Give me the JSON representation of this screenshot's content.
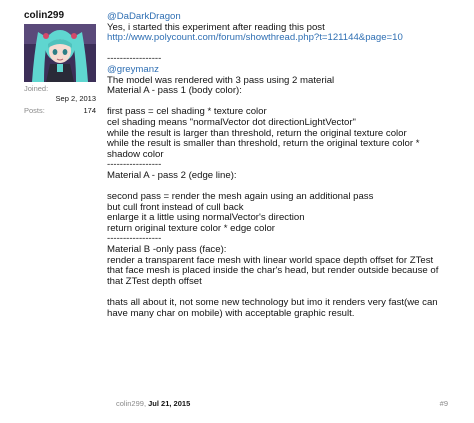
{
  "author": {
    "username": "colin299",
    "joined_label": "Joined:",
    "joined_value": "Sep 2, 2013",
    "posts_label": "Posts:",
    "posts_value": "174"
  },
  "post": {
    "lines": [
      {
        "text": "@DaDarkDragon",
        "style": "quote-name"
      },
      {
        "text": "Yes, i started this experiment after reading this post",
        "style": ""
      },
      {
        "text": "http://www.polycount.com/forum/showthread.php?t=121144&page=10",
        "style": "link"
      },
      {
        "text": "",
        "style": "gap"
      },
      {
        "text": "-----------------",
        "style": ""
      },
      {
        "text": "@greymanz",
        "style": "quote-name"
      },
      {
        "text": "The model was rendered with 3 pass using 2 material",
        "style": ""
      },
      {
        "text": "Material A - pass 1 (body color):",
        "style": ""
      },
      {
        "text": "",
        "style": "gap"
      },
      {
        "text": "first pass = cel shading * texture color",
        "style": ""
      },
      {
        "text": "cel shading means \"normalVector dot directionLightVector\"",
        "style": ""
      },
      {
        "text": "while the result is larger than threshold, return the original texture color",
        "style": ""
      },
      {
        "text": "while the result is smaller than threshold, return the original texture color *",
        "style": ""
      },
      {
        "text": "shadow color",
        "style": ""
      },
      {
        "text": "-----------------",
        "style": ""
      },
      {
        "text": "Material A - pass 2 (edge line):",
        "style": ""
      },
      {
        "text": "",
        "style": "gap"
      },
      {
        "text": "second pass = render the mesh again using an additional pass",
        "style": ""
      },
      {
        "text": "but cull front instead of cull back",
        "style": ""
      },
      {
        "text": "enlarge it a little using normalVector's direction",
        "style": ""
      },
      {
        "text": "return original texture color * edge color",
        "style": ""
      },
      {
        "text": "-----------------",
        "style": ""
      },
      {
        "text": "Material B -only pass (face):",
        "style": ""
      },
      {
        "text": "render a transparent face mesh with linear world space depth offset for ZTest",
        "style": ""
      },
      {
        "text": "that face mesh is placed inside the char's head, but render outside because of",
        "style": ""
      },
      {
        "text": "that ZTest depth offset",
        "style": ""
      },
      {
        "text": "",
        "style": "gap"
      },
      {
        "text": "thats all about it, not some new technology but imo it renders very fast(we can",
        "style": ""
      },
      {
        "text": "have many char on mobile) with acceptable graphic result.",
        "style": ""
      }
    ]
  },
  "footer": {
    "author": "colin299,",
    "date": "Jul 21, 2015",
    "post_number": "#9"
  },
  "colors": {
    "link": "#2f6fb3",
    "muted": "#8a8a8a",
    "text": "#141414",
    "avatar_bg": "#3c2f58",
    "avatar_hair": "#5fd6d0"
  }
}
